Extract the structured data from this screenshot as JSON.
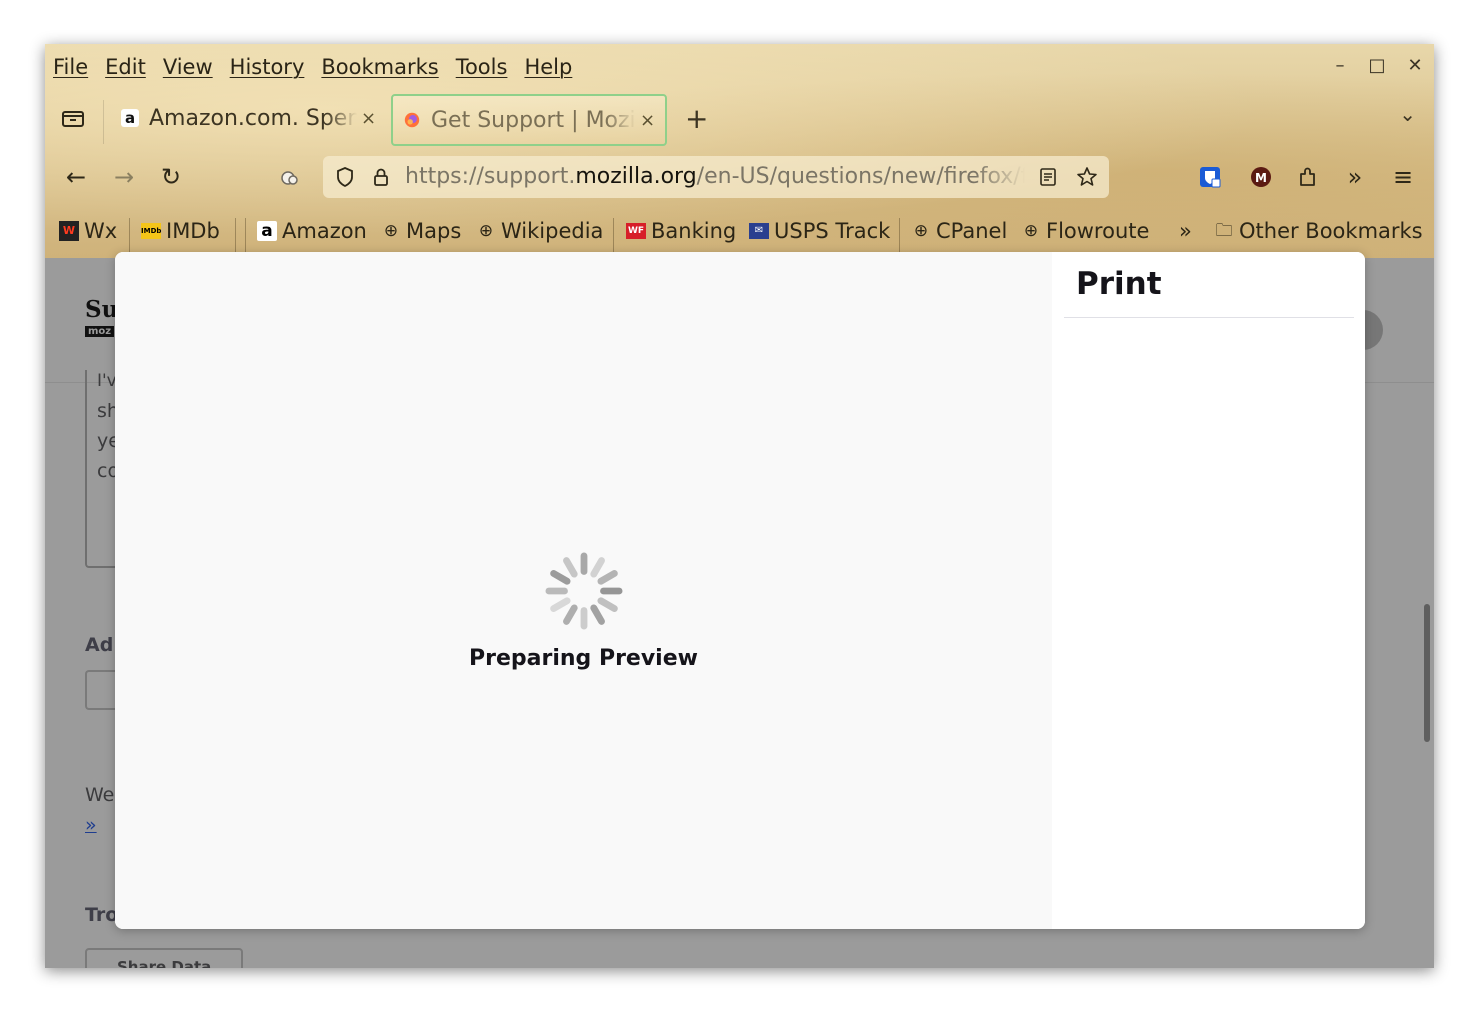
{
  "menubar": {
    "items": [
      "File",
      "Edit",
      "View",
      "History",
      "Bookmarks",
      "Tools",
      "Help"
    ]
  },
  "window_controls": {
    "minimize": "–",
    "maximize": "□",
    "close": "✕"
  },
  "tabs": [
    {
      "title": "Amazon.com. Spend less. Smile more.",
      "active": false,
      "close": "×"
    },
    {
      "title": "Get Support | Mozilla Support",
      "active": true,
      "close": "×"
    }
  ],
  "tabbar": {
    "new_tab": "+",
    "overflow": "⌄"
  },
  "nav": {
    "back": "←",
    "forward": "→",
    "reload": "↻",
    "url_prefix": "https://support.",
    "url_domain": "mozilla.org",
    "url_path": "/en-US/questions/new/firefox/form"
  },
  "bookmarks": [
    {
      "label": "Wx",
      "icon": "wx-icon"
    },
    {
      "label": "IMDb",
      "icon": "imdb-icon"
    },
    {
      "label": "Amazon",
      "icon": "amazon-icon"
    },
    {
      "label": "Maps",
      "icon": "globe-icon"
    },
    {
      "label": "Wikipedia",
      "icon": "globe-icon"
    },
    {
      "label": "Banking",
      "icon": "wf-icon"
    },
    {
      "label": "USPS Track",
      "icon": "usps-icon"
    },
    {
      "label": "CPanel",
      "icon": "globe-icon"
    },
    {
      "label": "Flowroute",
      "icon": "globe-icon"
    },
    {
      "label": "Other Bookmarks",
      "icon": "folder-icon"
    }
  ],
  "bookmarks_overflow": "»",
  "page_fragments": {
    "logo": "Su",
    "logo_sub": "moz",
    "line1": "I'v",
    "line2": "sh",
    "line3": "ye",
    "line4": "co",
    "heading_add": "Ad",
    "text_we": "We",
    "link_more": "»",
    "heading_tro": "Tro",
    "share_button": "Share Data"
  },
  "dialog": {
    "title": "Print",
    "status": "Preparing Preview"
  },
  "colors": {
    "accent_tab_border": "#8fd08a",
    "dialog_bg": "#f9f9f9",
    "overlay": "#9b9b9b"
  }
}
